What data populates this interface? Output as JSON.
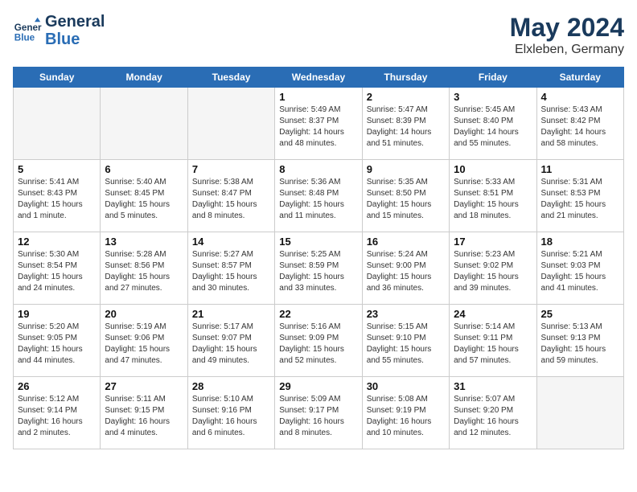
{
  "header": {
    "logo_line1": "General",
    "logo_line2": "Blue",
    "month_year": "May 2024",
    "location": "Elxleben, Germany"
  },
  "weekdays": [
    "Sunday",
    "Monday",
    "Tuesday",
    "Wednesday",
    "Thursday",
    "Friday",
    "Saturday"
  ],
  "weeks": [
    [
      {
        "day": "",
        "info": "",
        "empty": true
      },
      {
        "day": "",
        "info": "",
        "empty": true
      },
      {
        "day": "",
        "info": "",
        "empty": true
      },
      {
        "day": "1",
        "info": "Sunrise: 5:49 AM\nSunset: 8:37 PM\nDaylight: 14 hours\nand 48 minutes."
      },
      {
        "day": "2",
        "info": "Sunrise: 5:47 AM\nSunset: 8:39 PM\nDaylight: 14 hours\nand 51 minutes."
      },
      {
        "day": "3",
        "info": "Sunrise: 5:45 AM\nSunset: 8:40 PM\nDaylight: 14 hours\nand 55 minutes."
      },
      {
        "day": "4",
        "info": "Sunrise: 5:43 AM\nSunset: 8:42 PM\nDaylight: 14 hours\nand 58 minutes."
      }
    ],
    [
      {
        "day": "5",
        "info": "Sunrise: 5:41 AM\nSunset: 8:43 PM\nDaylight: 15 hours\nand 1 minute."
      },
      {
        "day": "6",
        "info": "Sunrise: 5:40 AM\nSunset: 8:45 PM\nDaylight: 15 hours\nand 5 minutes."
      },
      {
        "day": "7",
        "info": "Sunrise: 5:38 AM\nSunset: 8:47 PM\nDaylight: 15 hours\nand 8 minutes."
      },
      {
        "day": "8",
        "info": "Sunrise: 5:36 AM\nSunset: 8:48 PM\nDaylight: 15 hours\nand 11 minutes."
      },
      {
        "day": "9",
        "info": "Sunrise: 5:35 AM\nSunset: 8:50 PM\nDaylight: 15 hours\nand 15 minutes."
      },
      {
        "day": "10",
        "info": "Sunrise: 5:33 AM\nSunset: 8:51 PM\nDaylight: 15 hours\nand 18 minutes."
      },
      {
        "day": "11",
        "info": "Sunrise: 5:31 AM\nSunset: 8:53 PM\nDaylight: 15 hours\nand 21 minutes."
      }
    ],
    [
      {
        "day": "12",
        "info": "Sunrise: 5:30 AM\nSunset: 8:54 PM\nDaylight: 15 hours\nand 24 minutes."
      },
      {
        "day": "13",
        "info": "Sunrise: 5:28 AM\nSunset: 8:56 PM\nDaylight: 15 hours\nand 27 minutes."
      },
      {
        "day": "14",
        "info": "Sunrise: 5:27 AM\nSunset: 8:57 PM\nDaylight: 15 hours\nand 30 minutes."
      },
      {
        "day": "15",
        "info": "Sunrise: 5:25 AM\nSunset: 8:59 PM\nDaylight: 15 hours\nand 33 minutes."
      },
      {
        "day": "16",
        "info": "Sunrise: 5:24 AM\nSunset: 9:00 PM\nDaylight: 15 hours\nand 36 minutes."
      },
      {
        "day": "17",
        "info": "Sunrise: 5:23 AM\nSunset: 9:02 PM\nDaylight: 15 hours\nand 39 minutes."
      },
      {
        "day": "18",
        "info": "Sunrise: 5:21 AM\nSunset: 9:03 PM\nDaylight: 15 hours\nand 41 minutes."
      }
    ],
    [
      {
        "day": "19",
        "info": "Sunrise: 5:20 AM\nSunset: 9:05 PM\nDaylight: 15 hours\nand 44 minutes."
      },
      {
        "day": "20",
        "info": "Sunrise: 5:19 AM\nSunset: 9:06 PM\nDaylight: 15 hours\nand 47 minutes."
      },
      {
        "day": "21",
        "info": "Sunrise: 5:17 AM\nSunset: 9:07 PM\nDaylight: 15 hours\nand 49 minutes."
      },
      {
        "day": "22",
        "info": "Sunrise: 5:16 AM\nSunset: 9:09 PM\nDaylight: 15 hours\nand 52 minutes."
      },
      {
        "day": "23",
        "info": "Sunrise: 5:15 AM\nSunset: 9:10 PM\nDaylight: 15 hours\nand 55 minutes."
      },
      {
        "day": "24",
        "info": "Sunrise: 5:14 AM\nSunset: 9:11 PM\nDaylight: 15 hours\nand 57 minutes."
      },
      {
        "day": "25",
        "info": "Sunrise: 5:13 AM\nSunset: 9:13 PM\nDaylight: 15 hours\nand 59 minutes."
      }
    ],
    [
      {
        "day": "26",
        "info": "Sunrise: 5:12 AM\nSunset: 9:14 PM\nDaylight: 16 hours\nand 2 minutes."
      },
      {
        "day": "27",
        "info": "Sunrise: 5:11 AM\nSunset: 9:15 PM\nDaylight: 16 hours\nand 4 minutes."
      },
      {
        "day": "28",
        "info": "Sunrise: 5:10 AM\nSunset: 9:16 PM\nDaylight: 16 hours\nand 6 minutes."
      },
      {
        "day": "29",
        "info": "Sunrise: 5:09 AM\nSunset: 9:17 PM\nDaylight: 16 hours\nand 8 minutes."
      },
      {
        "day": "30",
        "info": "Sunrise: 5:08 AM\nSunset: 9:19 PM\nDaylight: 16 hours\nand 10 minutes."
      },
      {
        "day": "31",
        "info": "Sunrise: 5:07 AM\nSunset: 9:20 PM\nDaylight: 16 hours\nand 12 minutes."
      },
      {
        "day": "",
        "info": "",
        "empty": true
      }
    ]
  ]
}
